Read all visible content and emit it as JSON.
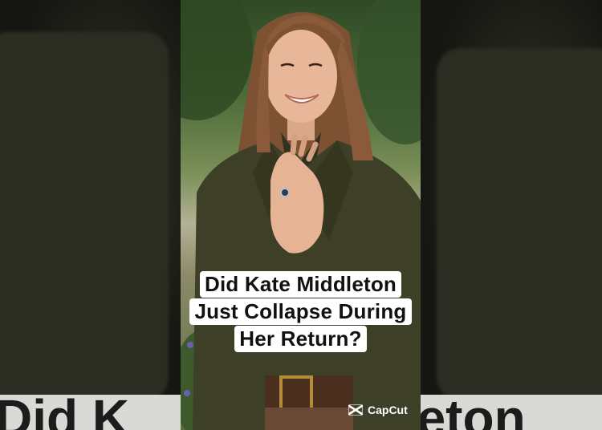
{
  "caption": {
    "line1": "Did Kate Middleton",
    "line2": "Just Collapse During",
    "line3": "Her Return?"
  },
  "watermark": {
    "brand": "CapCut",
    "icon": "capcut-logo-icon"
  },
  "background_text": {
    "left": "Did K",
    "right": "lleton"
  },
  "colors": {
    "caption_bg": "#ffffff",
    "caption_text": "#111111",
    "coat": "#3d3f26",
    "hair": "#8a5a3a"
  }
}
